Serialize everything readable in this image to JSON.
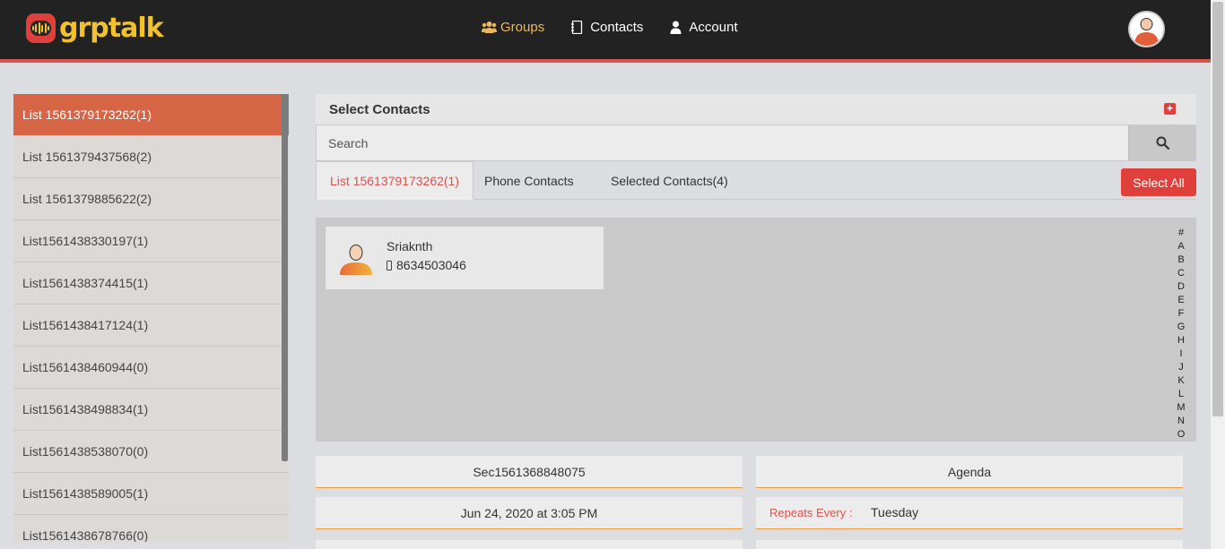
{
  "header": {
    "logo_text": "grptalk",
    "nav": [
      {
        "label": "Groups",
        "icon": "groups-icon",
        "active": true
      },
      {
        "label": "Contacts",
        "icon": "address-book-icon",
        "active": false
      },
      {
        "label": "Account",
        "icon": "user-icon",
        "active": false
      }
    ],
    "accent_color": "#d9534f"
  },
  "sidebar": {
    "items": [
      {
        "label": "List 1561379173262(1)",
        "active": true
      },
      {
        "label": "List 1561379437568(2)"
      },
      {
        "label": "List 1561379885622(2)"
      },
      {
        "label": "List1561438330197(1)"
      },
      {
        "label": "List1561438374415(1)"
      },
      {
        "label": "List1561438417124(1)"
      },
      {
        "label": "List1561438460944(0)"
      },
      {
        "label": "List1561438498834(1)"
      },
      {
        "label": "List1561438538070(0)"
      },
      {
        "label": "List1561438589005(1)"
      },
      {
        "label": "List1561438678766(0)"
      }
    ]
  },
  "main": {
    "title": "Select Contacts",
    "search": {
      "placeholder": "Search",
      "value": ""
    },
    "tabs": [
      {
        "label": "List 1561379173262(1)",
        "active": true
      },
      {
        "label": "Phone Contacts"
      },
      {
        "label": "Selected Contacts(4)"
      }
    ],
    "select_all_label": "Select All",
    "contacts": [
      {
        "name": "Sriaknth",
        "phone": "8634503046"
      }
    ],
    "alphabet": [
      "#",
      "A",
      "B",
      "C",
      "D",
      "E",
      "F",
      "G",
      "H",
      "I",
      "J",
      "K",
      "L",
      "M",
      "N",
      "O"
    ]
  },
  "details": {
    "section_name": "Sec1561368848075",
    "agenda": "Agenda",
    "datetime": "Jun 24, 2020 at 3:05 PM",
    "repeats_label": "Repeats Every :",
    "repeats_value": "Tuesday"
  }
}
